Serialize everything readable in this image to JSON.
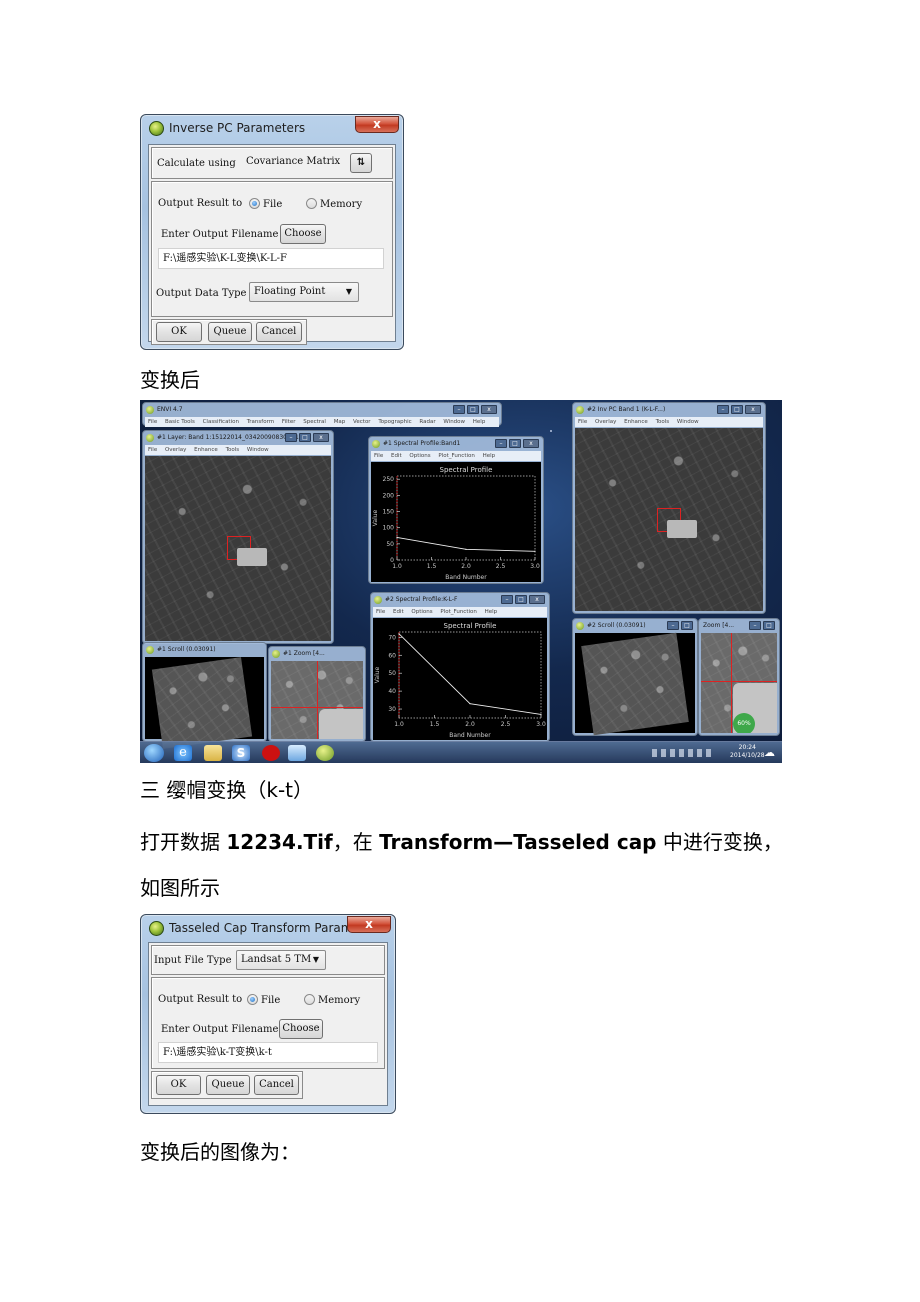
{
  "dialog_pc": {
    "title": "Inverse PC Parameters",
    "close_label": "x",
    "calculate_label": "Calculate using",
    "calculate_value": "Covariance Matrix",
    "toggle_icon": "sort-arrows-icon",
    "toggle_glyph": "⇅",
    "output_label": "Output Result to",
    "radio_file": "File",
    "radio_memory": "Memory",
    "radio_selected": "File",
    "filename_label": "Enter Output Filename",
    "choose_label": "Choose",
    "filename_value": "F:\\遥感实验\\K-L变换\\K-L-F",
    "datatype_label": "Output Data Type",
    "datatype_value": "Floating Point",
    "ok_label": "OK",
    "queue_label": "Queue",
    "cancel_label": "Cancel"
  },
  "caption_after": "变换后",
  "screenshot": {
    "envi_title": "ENVI 4.7",
    "envi_menu": [
      "File",
      "Basic Tools",
      "Classification",
      "Transform",
      "Filter",
      "Spectral",
      "Map",
      "Vector",
      "Topographic",
      "Radar",
      "Window",
      "Help"
    ],
    "layer_title": "#1 Layer: Band 1:15122014_03420090830_#1...",
    "display_menu": [
      "File",
      "Overlay",
      "Enhance",
      "Tools",
      "Window"
    ],
    "invpc_title": "#2 Inv PC Band 1 (K-L-F...)",
    "scroll1_title": "#1 Scroll (0.03091)",
    "zoom1_title": "#1 Zoom [4...",
    "scroll2_title": "#2 Scroll (0.03091)",
    "zoom2_title": "Zoom [4...",
    "profile1_title": "#1 Spectral Profile:Band1",
    "profile2_title": "#2 Spectral Profile:K-L-F",
    "profile_menu": [
      "File",
      "Edit",
      "Options",
      "Plot_Function",
      "Help"
    ],
    "clock_time": "20:24",
    "clock_date": "2014/10/28",
    "badge": "60%"
  },
  "chart_data": [
    {
      "type": "line",
      "title": "Spectral Profile",
      "xlabel": "Band Number",
      "ylabel": "Value",
      "x": [
        1.0,
        2.0,
        3.0
      ],
      "y": [
        70,
        33,
        27
      ],
      "xlim": [
        1.0,
        3.0
      ],
      "ylim": [
        0,
        260
      ],
      "xticks": [
        "1.0",
        "1.5",
        "2.0",
        "2.5",
        "3.0"
      ],
      "yticks": [
        "0",
        "50",
        "100",
        "150",
        "200",
        "250"
      ]
    },
    {
      "type": "line",
      "title": "Spectral Profile",
      "xlabel": "Band Number",
      "ylabel": "Value",
      "x": [
        1.0,
        2.0,
        3.0
      ],
      "y": [
        72,
        33,
        27
      ],
      "xlim": [
        1.0,
        3.0
      ],
      "ylim": [
        25,
        73
      ],
      "xticks": [
        "1.0",
        "1.5",
        "2.0",
        "2.5",
        "3.0"
      ],
      "yticks": [
        "30",
        "40",
        "50",
        "60",
        "70"
      ]
    }
  ],
  "section_heading": "三  缨帽变换（k-t）",
  "para_line1_prefix": "打开数据 ",
  "para_line1_file": "12234.Tif",
  "para_line1_mid": "，在 ",
  "para_line1_menu": "Transform—Tasseled cap",
  "para_line1_suffix": " 中进行变换，",
  "para_line2": "如图所示",
  "dialog_tc": {
    "title": "Tasseled Cap Transform Parameters",
    "close_label": "x",
    "input_type_label": "Input File Type",
    "input_type_value": "Landsat 5 TM",
    "output_label": "Output Result to",
    "radio_file": "File",
    "radio_memory": "Memory",
    "radio_selected": "File",
    "filename_label": "Enter Output Filename",
    "choose_label": "Choose",
    "filename_value": "F:\\遥感实验\\k-T变换\\k-t",
    "ok_label": "OK",
    "queue_label": "Queue",
    "cancel_label": "Cancel"
  },
  "caption_result": "变换后的图像为："
}
